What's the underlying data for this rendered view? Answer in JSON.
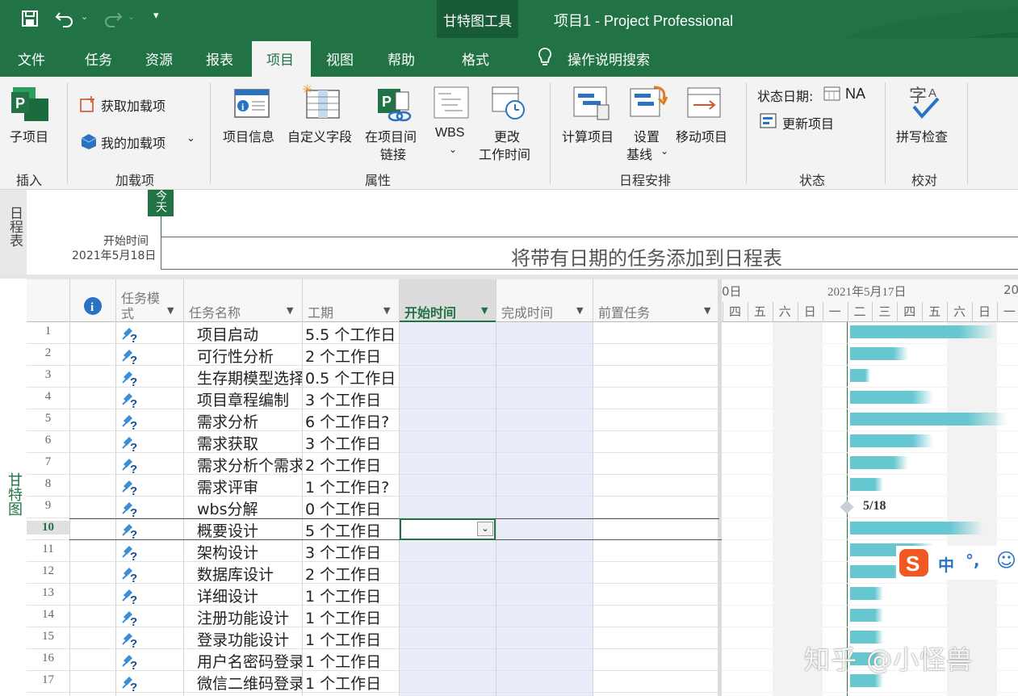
{
  "titlebar": {
    "context_tools": "甘特图工具",
    "app_title": "项目1  -  Project Professional"
  },
  "tabs": [
    "文件",
    "任务",
    "资源",
    "报表",
    "项目",
    "视图",
    "帮助",
    "格式"
  ],
  "tell_me": "操作说明搜索",
  "ribbon": {
    "subproject": "子项目",
    "get_addins": "获取加载项",
    "my_addins": "我的加载项",
    "project_info": "项目信息",
    "custom_fields": "自定义字段",
    "links_line1": "在项目间",
    "links_line2": "链接",
    "wbs": "WBS",
    "change_time_line1": "更改",
    "change_time_line2": "工作时间",
    "calc_project": "计算项目",
    "set_baseline_line1": "设置",
    "set_baseline_line2": "基线",
    "move_project": "移动项目",
    "status_date_label": "状态日期:",
    "status_date_value": "NA",
    "update_project": "更新项目",
    "spelling": "拼写检查",
    "groups": {
      "insert": "插入",
      "addins": "加载项",
      "properties": "属性",
      "schedule": "日程安排",
      "status": "状态",
      "proofing": "校对"
    }
  },
  "timeline": {
    "side_label": "日程表",
    "today": "今天",
    "start_label": "开始时间",
    "start_date": "2021年5月18日",
    "placeholder": "将带有日期的任务添加到日程表"
  },
  "gantt_side_label": "甘特图",
  "columns": {
    "info": "i",
    "mode_line1": "任务模",
    "mode_line2": "式",
    "name": "任务名称",
    "duration": "工期",
    "start": "开始时间",
    "finish": "完成时间",
    "predecessors": "前置任务"
  },
  "chart_header": {
    "prev_week": "0日",
    "week_label": "2021年5月17日",
    "next_week": "20",
    "days": [
      "四",
      "五",
      "六",
      "日",
      "一",
      "二",
      "三",
      "四",
      "五",
      "六",
      "日",
      "一"
    ]
  },
  "tasks": [
    {
      "id": "1",
      "name": "项目启动",
      "duration": "5.5 个工作日",
      "bar_days": 5.5
    },
    {
      "id": "2",
      "name": "可行性分析",
      "duration": "2 个工作日",
      "bar_days": 2
    },
    {
      "id": "3",
      "name": "生存期模型选择",
      "duration": "0.5 个工作日",
      "bar_days": 0.5
    },
    {
      "id": "4",
      "name": "项目章程编制",
      "duration": "3 个工作日",
      "bar_days": 3
    },
    {
      "id": "5",
      "name": "需求分析",
      "duration": "6 个工作日?",
      "bar_days": 6
    },
    {
      "id": "6",
      "name": "需求获取",
      "duration": "3 个工作日",
      "bar_days": 3
    },
    {
      "id": "7",
      "name": "需求分析个需求",
      "duration": "2 个工作日",
      "bar_days": 2
    },
    {
      "id": "8",
      "name": "需求评审",
      "duration": "1 个工作日?",
      "bar_days": 1
    },
    {
      "id": "9",
      "name": "wbs分解",
      "duration": "0 个工作日",
      "bar_days": 0,
      "milestone": "5/18"
    },
    {
      "id": "10",
      "name": "概要设计",
      "duration": "5 个工作日",
      "bar_days": 5
    },
    {
      "id": "11",
      "name": "架构设计",
      "duration": "3 个工作日",
      "bar_days": 3
    },
    {
      "id": "12",
      "name": "数据库设计",
      "duration": "2 个工作日",
      "bar_days": 2
    },
    {
      "id": "13",
      "name": "详细设计",
      "duration": "1 个工作日",
      "bar_days": 1
    },
    {
      "id": "14",
      "name": "注册功能设计",
      "duration": "1 个工作日",
      "bar_days": 1
    },
    {
      "id": "15",
      "name": "登录功能设计",
      "duration": "1 个工作日",
      "bar_days": 1
    },
    {
      "id": "16",
      "name": "用户名密码登录",
      "duration": "1 个工作日",
      "bar_days": 1
    },
    {
      "id": "17",
      "name": "微信二维码登录",
      "duration": "1 个工作日",
      "bar_days": 1
    }
  ],
  "ime": {
    "lang": "中",
    "punct": "°,",
    "emoji": "☺"
  },
  "watermark": "知乎 @小怪兽",
  "colors": {
    "accent": "#217346",
    "bar": "#67c7d0",
    "selected_column": "#e9edf9"
  }
}
